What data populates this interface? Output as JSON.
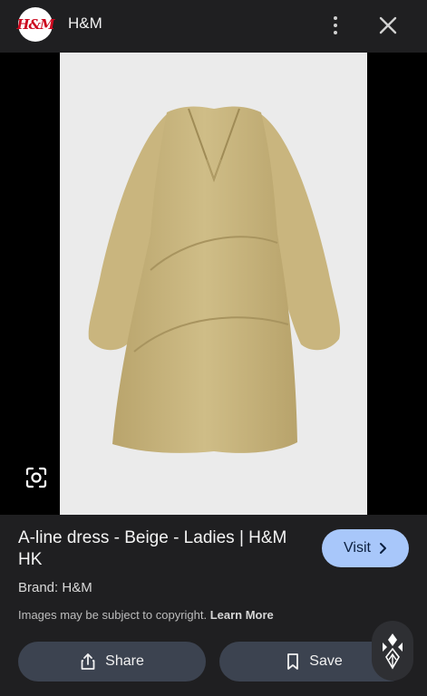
{
  "header": {
    "logo_text": "H&M",
    "site_name": "H&M"
  },
  "product": {
    "title": "A-line dress - Beige - Ladies | H&M HK",
    "brand": "Brand: H&M",
    "dress_color": "#c9b57e"
  },
  "actions": {
    "visit_label": "Visit",
    "share_label": "Share",
    "save_label": "Save"
  },
  "notice": {
    "text": "Images may be subject to copyright. ",
    "link": "Learn More"
  },
  "colors": {
    "background": "#1f1f21",
    "visit_button": "#a8c7fa",
    "action_button": "#3c4350",
    "brand_red": "#cc071e"
  },
  "icons": [
    "more-vert-icon",
    "close-icon",
    "lens-search-icon",
    "chevron-right-icon",
    "share-icon",
    "bookmark-icon",
    "assistant-icon"
  ]
}
